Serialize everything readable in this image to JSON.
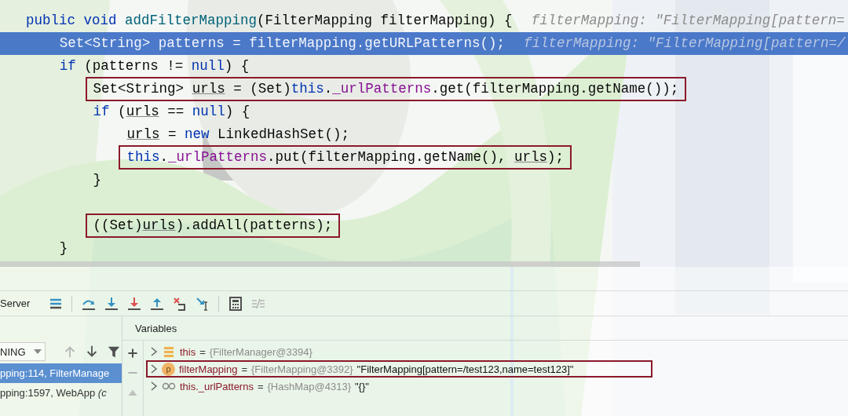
{
  "editor": {
    "lines": [
      {
        "tokens": [
          {
            "kind": "keyword",
            "text": "public void "
          },
          {
            "kind": "method",
            "text": "addFilterMapping"
          },
          {
            "kind": "plain",
            "text": "(FilterMapping filterMapping) {"
          }
        ],
        "hint": "filterMapping: \"FilterMapping[pattern=",
        "current": false,
        "boxed": false,
        "children": [
          {
            "tokens": [
              {
                "kind": "plain",
                "text": "Set<String> patterns = filterMapping.getURLPatterns();"
              }
            ],
            "hint": "filterMapping: \"FilterMapping[pattern=/",
            "current": true,
            "boxed": false
          },
          {
            "tokens": [
              {
                "kind": "keyword",
                "text": "if"
              },
              {
                "kind": "plain",
                "text": " (patterns != "
              },
              {
                "kind": "keyword",
                "text": "null"
              },
              {
                "kind": "plain",
                "text": ") {"
              }
            ],
            "current": false,
            "boxed": false,
            "children": [
              {
                "tokens": [
                  {
                    "kind": "plain",
                    "text": "Set<String> "
                  },
                  {
                    "kind": "local",
                    "text": "urls"
                  },
                  {
                    "kind": "plain",
                    "text": " = (Set)"
                  },
                  {
                    "kind": "keyword",
                    "text": "this"
                  },
                  {
                    "kind": "plain",
                    "text": "."
                  },
                  {
                    "kind": "field",
                    "text": "_urlPatterns"
                  },
                  {
                    "kind": "plain",
                    "text": ".get(filterMapping.getName());"
                  }
                ],
                "current": false,
                "boxed": true
              },
              {
                "tokens": [
                  {
                    "kind": "keyword",
                    "text": "if"
                  },
                  {
                    "kind": "plain",
                    "text": " ("
                  },
                  {
                    "kind": "local",
                    "text": "urls"
                  },
                  {
                    "kind": "plain",
                    "text": " == "
                  },
                  {
                    "kind": "keyword",
                    "text": "null"
                  },
                  {
                    "kind": "plain",
                    "text": ") {"
                  }
                ],
                "current": false,
                "boxed": false,
                "children": [
                  {
                    "tokens": [
                      {
                        "kind": "local",
                        "text": "urls"
                      },
                      {
                        "kind": "plain",
                        "text": " = "
                      },
                      {
                        "kind": "keyword",
                        "text": "new"
                      },
                      {
                        "kind": "plain",
                        "text": " LinkedHashSet();"
                      }
                    ],
                    "current": false,
                    "boxed": false
                  },
                  {
                    "tokens": [
                      {
                        "kind": "keyword",
                        "text": "this"
                      },
                      {
                        "kind": "plain",
                        "text": "."
                      },
                      {
                        "kind": "field",
                        "text": "_urlPatterns"
                      },
                      {
                        "kind": "plain",
                        "text": ".put(filterMapping.getName(), "
                      },
                      {
                        "kind": "local",
                        "text": "urls"
                      },
                      {
                        "kind": "plain",
                        "text": ");"
                      }
                    ],
                    "current": false,
                    "boxed": true
                  }
                ]
              },
              {
                "tokens": [
                  {
                    "kind": "plain",
                    "text": "}"
                  }
                ],
                "current": false,
                "boxed": false
              },
              {
                "tokens": [
                  {
                    "kind": "plain",
                    "text": "((Set)"
                  },
                  {
                    "kind": "local",
                    "text": "urls"
                  },
                  {
                    "kind": "plain",
                    "text": ").addAll(patterns);"
                  }
                ],
                "current": false,
                "boxed": true,
                "blank_line_before": true
              }
            ]
          },
          {
            "tokens": [
              {
                "kind": "plain",
                "text": "}"
              }
            ],
            "current": false,
            "boxed": false
          }
        ]
      }
    ]
  },
  "debugger": {
    "toolbar": {
      "title": "Server",
      "buttons": [
        {
          "kind": "menu",
          "disabled": false
        },
        {
          "kind": "separator"
        },
        {
          "kind": "step-over",
          "disabled": false
        },
        {
          "kind": "step-into",
          "disabled": false
        },
        {
          "kind": "force-step-into",
          "disabled": false
        },
        {
          "kind": "step-out",
          "disabled": false
        },
        {
          "kind": "drop-frame",
          "disabled": false
        },
        {
          "kind": "run-to-cursor",
          "disabled": false
        },
        {
          "kind": "separator"
        },
        {
          "kind": "evaluate",
          "disabled": false
        },
        {
          "kind": "trace",
          "disabled": true
        }
      ]
    },
    "frames": {
      "thread": "NING",
      "nav": [
        {
          "kind": "up",
          "disabled": true
        },
        {
          "kind": "down",
          "disabled": false
        },
        {
          "kind": "filter",
          "disabled": false
        }
      ],
      "items": [
        {
          "text": "pping:114, FilterManage",
          "selected": true
        },
        {
          "text": "pping:1597, WebApp *(c*",
          "selected": false
        }
      ]
    },
    "side_buttons": [
      {
        "kind": "add",
        "disabled": false
      },
      {
        "kind": "remove",
        "disabled": true
      },
      {
        "kind": "up",
        "disabled": true
      }
    ],
    "variables": {
      "title": "Variables",
      "items": [
        {
          "kind": "field-list",
          "name": "this",
          "operator": "=",
          "value": "{FilterManager@3394}",
          "boxed": false
        },
        {
          "kind": "param",
          "badge": "p",
          "name": "filterMapping",
          "operator": "=",
          "value": "{FilterMapping@3392}",
          "string": "\"FilterMapping[pattern=/test123,name=test123]\"",
          "boxed": true
        },
        {
          "kind": "watch",
          "name": "this._urlPatterns",
          "operator": "=",
          "value": "{HashMap@4313}",
          "string": "\"{}\"",
          "boxed": false
        }
      ]
    }
  }
}
